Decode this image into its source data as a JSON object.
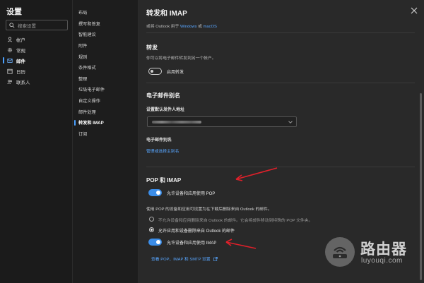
{
  "sidebar": {
    "title": "设置",
    "search_placeholder": "搜索设置",
    "items": [
      {
        "label": "帐户",
        "icon": "person-icon"
      },
      {
        "label": "常规",
        "icon": "gear-icon"
      },
      {
        "label": "邮件",
        "icon": "mail-icon",
        "active": true
      },
      {
        "label": "日历",
        "icon": "calendar-icon"
      },
      {
        "label": "联系人",
        "icon": "people-icon"
      }
    ]
  },
  "subnav": {
    "items": [
      "布局",
      "撰写和答复",
      "智能建议",
      "附件",
      "规则",
      "条件格式",
      "整理",
      "垃圾电子邮件",
      "自定义操作",
      "邮件处理",
      "转发和 IMAP",
      "订阅"
    ],
    "active_index": 10
  },
  "panel": {
    "title": "转发和 IMAP",
    "top_hint": {
      "prefix": "或将 Outlook 用于 ",
      "link1": "Windows",
      "middle": " 或 ",
      "link2": "macOS"
    },
    "forwarding": {
      "heading": "转发",
      "description": "你可以将电子邮件转发到另一个帐户。",
      "toggle_label": "启用转发",
      "toggle_on": false
    },
    "alias": {
      "heading": "电子邮件别名",
      "default_from_label": "设置默认发件人地址",
      "alias_label": "电子邮件别名",
      "manage_link": "管理或选择主别名"
    },
    "pop_imap": {
      "heading": "POP 和 IMAP",
      "pop_toggle_label": "允许设备和应用使用 POP",
      "pop_toggle_on": true,
      "pop_description": "使用 POP 的设备和应用可设置为在下载后删除来自 Outlook 的邮件。",
      "radio1": "不允许设备和应用删除来自 Outlook 的邮件。它会将邮件移动到特殊的 POP 文件夹。",
      "radio2": "允许应用和设备删除来自 Outlook 的邮件",
      "radio_selected": 2,
      "imap_toggle_label": "允许设备和应用使用 IMAP",
      "imap_toggle_on": true,
      "settings_link": "查看 POP、IMAP 和 SMTP 设置"
    }
  },
  "watermark": {
    "name": "路由器",
    "url": "luyouqi.com"
  },
  "colors": {
    "accent": "#3b8de8",
    "link": "#58a6ff",
    "annotation": "#e0202a"
  }
}
